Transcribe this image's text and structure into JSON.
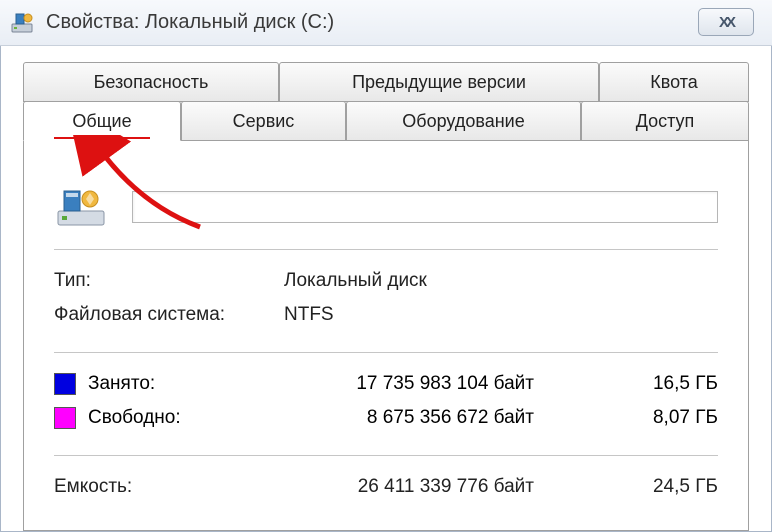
{
  "window": {
    "title": "Свойства: Локальный диск (C:)"
  },
  "tabs": {
    "row1": [
      {
        "label": "Безопасность"
      },
      {
        "label": "Предыдущие версии"
      },
      {
        "label": "Квота"
      }
    ],
    "row2": [
      {
        "label": "Общие",
        "active": true
      },
      {
        "label": "Сервис"
      },
      {
        "label": "Оборудование"
      },
      {
        "label": "Доступ"
      }
    ]
  },
  "general": {
    "type_label": "Тип:",
    "type_value": "Локальный диск",
    "fs_label": "Файловая система:",
    "fs_value": "NTFS",
    "used_label": "Занято:",
    "used_bytes": "17 735 983 104 байт",
    "used_gb": "16,5 ГБ",
    "free_label": "Свободно:",
    "free_bytes": "8 675 356 672 байт",
    "free_gb": "8,07 ГБ",
    "cap_label": "Емкость:",
    "cap_bytes": "26 411 339 776 байт",
    "cap_gb": "24,5 ГБ"
  },
  "colors": {
    "used": "#0000e0",
    "free": "#ff00ff",
    "arrow": "#d11"
  }
}
